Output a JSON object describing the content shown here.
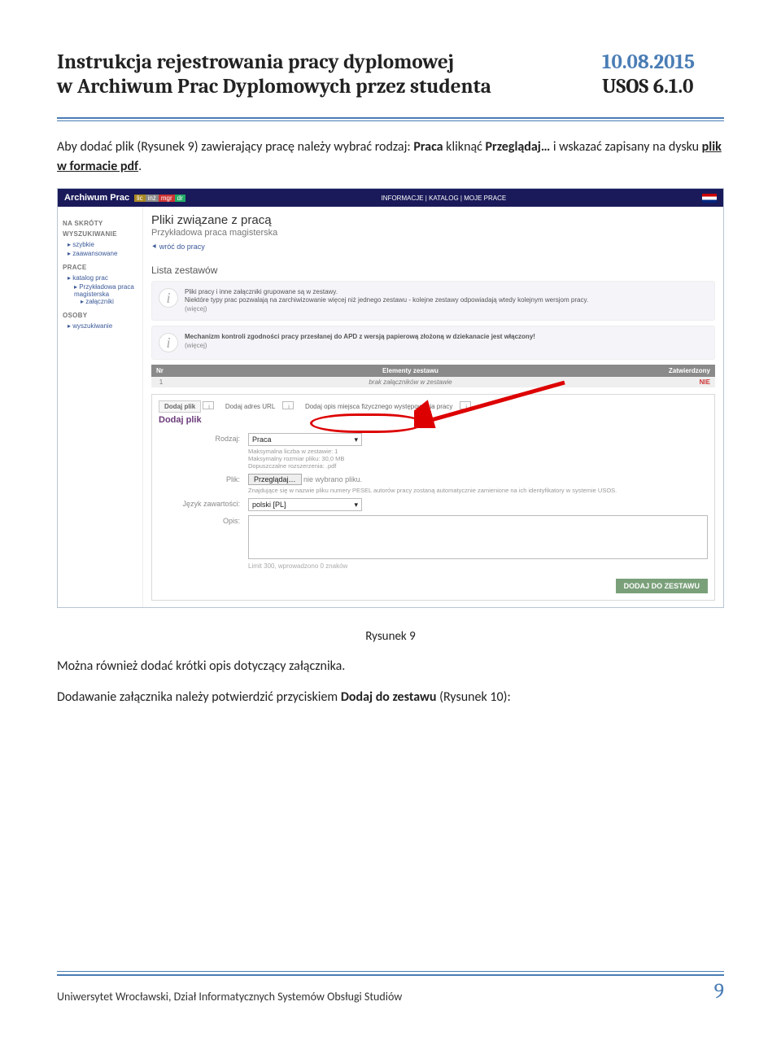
{
  "header": {
    "title1": "Instrukcja rejestrowania pracy dyplomowej",
    "title2": "w Archiwum Prac Dyplomowych przez studenta",
    "date": "10.08.2015",
    "version": "USOS 6.1.0"
  },
  "para1_parts": {
    "p1": "Aby dodać plik (Rysunek 9) zawierający pracę należy wybrać rodzaj: ",
    "bold1": "Praca",
    "p2": " kliknąć ",
    "bold2": "Przeglądaj…",
    "p3": " i wskazać zapisany na dysku ",
    "underline": "plik w formacie pdf",
    "p4": "."
  },
  "screenshot": {
    "brand": "Archiwum Prac",
    "subs": {
      "lic": "lic",
      "inz": "inż",
      "mgr": "mgr",
      "dr": "dr"
    },
    "nav_center": "INFORMACJE  |  KATALOG  |  MOJE PRACE",
    "side": {
      "h1": "NA SKRÓTY",
      "g1": "WYSZUKIWANIE",
      "i1a": "▸ szybkie",
      "i1b": "▸ zaawansowane",
      "g2": "PRACE",
      "i2a": "▸ katalog prac",
      "i2b": "▸ Przykładowa praca",
      "i2c": "magisterska",
      "i2d": "▸ załączniki",
      "g3": "OSOBY",
      "i3a": "▸ wyszukiwanie"
    },
    "main": {
      "title": "Pliki związane z pracą",
      "subtitle": "Przykładowa praca magisterska",
      "back": "⯇ wróć do pracy",
      "sec": "Lista zestawów",
      "info1_l1": "Pliki pracy i inne załączniki grupowane są w zestawy.",
      "info1_l2": "Niektóre typy prac pozwalają na zarchiwizowanie więcej niż jednego zestawu - kolejne zestawy odpowiadają wtedy kolejnym wersjom pracy.",
      "info_more": "(więcej)",
      "info2": "Mechanizm kontroli zgodności pracy przesłanej do APD z wersją papierową złożoną w dziekanacie jest włączony!",
      "th_nr": "Nr",
      "th_el": "Elementy zestawu",
      "th_zat": "Zatwierdzony",
      "td_nr": "1",
      "td_el": "brak załączników w zestawie",
      "td_zat": "NIE",
      "addnav1": "Dodaj plik",
      "addnav2": "Dodaj adres URL",
      "addnav3": "Dodaj opis miejsca fizycznego występowania pracy",
      "addtitle": "Dodaj plik",
      "lbl_rodzaj": "Rodzaj:",
      "rodzaj_val": "Praca",
      "rodzaj_h1": "Maksymalna liczba w zestawie: 1",
      "rodzaj_h2": "Maksymalny rozmiar pliku: 30,0 MB",
      "rodzaj_h3": "Dopuszczalne rozszerzenia: .pdf",
      "lbl_plik": "Plik:",
      "browse": "Przeglądaj…",
      "browse_after": "nie wybrano pliku.",
      "plik_hint": "Znajdujące się w nazwie pliku numery PESEL autorów pracy zostaną automatycznie zamienione na ich identyfikatory w systemie USOS.",
      "lbl_lang": "Język zawartości:",
      "lang_val": "polski [PL]",
      "lbl_opis": "Opis:",
      "limit": "Limit 300, wprowadzono 0 znaków",
      "addbtn": "DODAJ DO ZESTAWU"
    }
  },
  "caption": "Rysunek 9",
  "para2": "Można również dodać krótki opis dotyczący załącznika.",
  "para3_parts": {
    "p1": "Dodawanie załącznika należy potwierdzić przyciskiem ",
    "bold": "Dodaj do zestawu",
    "p2": " (Rysunek 10):"
  },
  "footer": {
    "text": "Uniwersytet Wrocławski, Dział Informatycznych Systemów Obsługi Studiów",
    "page": "9"
  }
}
